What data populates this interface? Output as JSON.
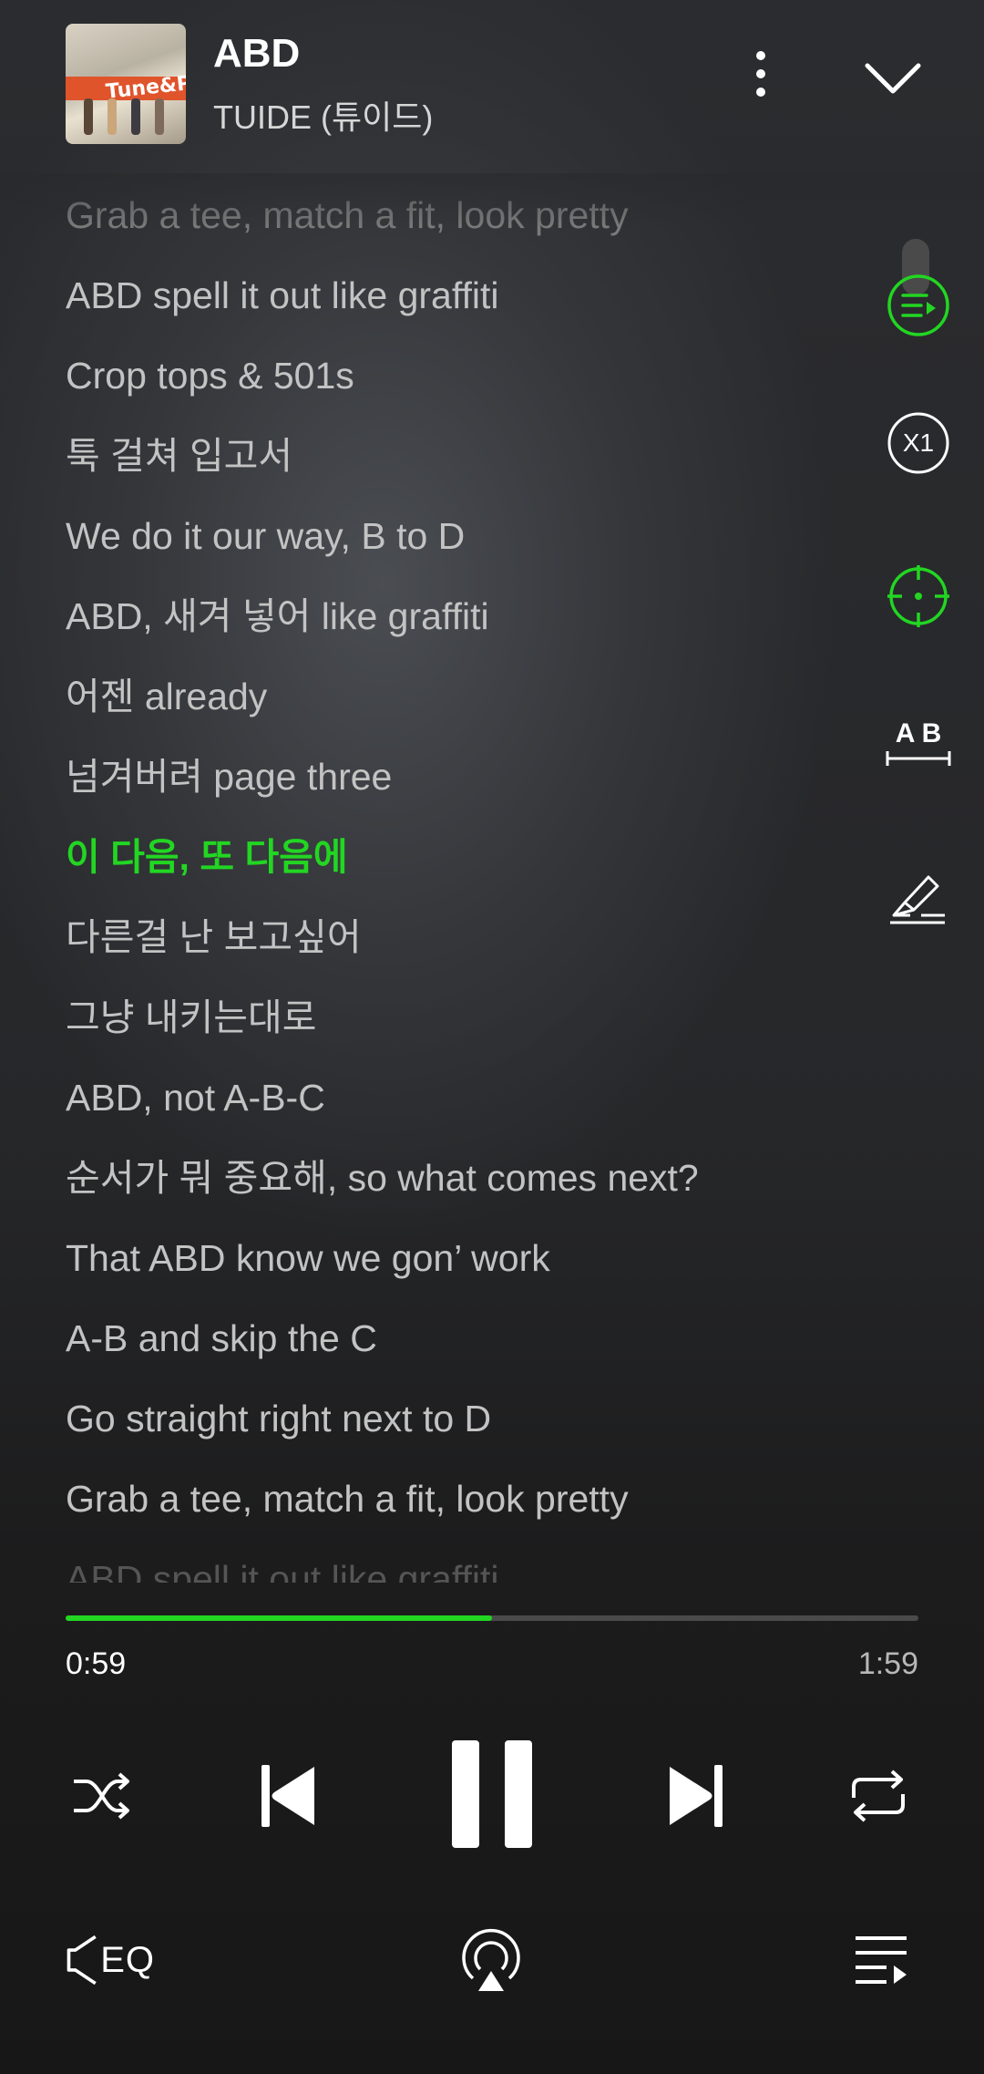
{
  "track": {
    "title": "ABD",
    "artist": "TUIDE (튜이드)",
    "cover_text": "Tune&Play"
  },
  "lyrics": [
    {
      "text": "Grab a tee, match a fit, look pretty",
      "state": "faded"
    },
    {
      "text": "ABD spell it out like graffiti",
      "state": "normal"
    },
    {
      "text": "Crop tops & 501s",
      "state": "normal"
    },
    {
      "text": "툭 걸쳐 입고서",
      "state": "normal"
    },
    {
      "text": "We do it our way, B to D",
      "state": "normal"
    },
    {
      "text": "ABD, 새겨 넣어 like graffiti",
      "state": "normal"
    },
    {
      "text": "어젠 already",
      "state": "normal"
    },
    {
      "text": "넘겨버려 page three",
      "state": "normal"
    },
    {
      "text": "이 다음, 또 다음에",
      "state": "current"
    },
    {
      "text": "다른걸 난 보고싶어",
      "state": "normal"
    },
    {
      "text": "그냥 내키는대로",
      "state": "normal"
    },
    {
      "text": "ABD, not A-B-C",
      "state": "normal"
    },
    {
      "text": "순서가 뭐 중요해, so what comes next?",
      "state": "normal"
    },
    {
      "text": "That ABD know we gon’ work",
      "state": "normal"
    },
    {
      "text": "A-B and skip the C",
      "state": "normal"
    },
    {
      "text": "Go straight right next to D",
      "state": "normal"
    },
    {
      "text": "Grab a tee, match a fit, look pretty",
      "state": "normal"
    },
    {
      "text": "ABD spell it out like graffiti",
      "state": "cut"
    }
  ],
  "tools": {
    "speed_label": "X1",
    "ab_label": "A B"
  },
  "playback": {
    "current_time": "0:59",
    "total_time": "1:59",
    "progress": 0.5
  },
  "bottom": {
    "eq_label": "EQ"
  },
  "colors": {
    "accent": "#22d622",
    "text": "#c3c3c3",
    "faded": "#7a7a7a"
  },
  "icons": [
    "more-vert-icon",
    "chevron-down-icon",
    "lyrics-sync-icon",
    "speed-icon",
    "locate-icon",
    "ab-repeat-icon",
    "highlight-icon",
    "shuffle-icon",
    "previous-icon",
    "pause-icon",
    "next-icon",
    "repeat-icon",
    "eq-icon",
    "cast-icon",
    "playlist-icon"
  ]
}
